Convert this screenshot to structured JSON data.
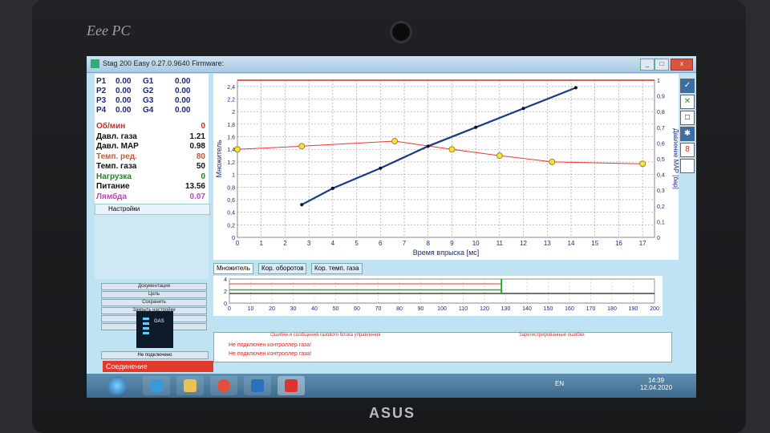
{
  "device": {
    "brand": "Eee PC",
    "maker": "ASUS"
  },
  "window": {
    "title": "Stag 200 Easy 0.27.0.9640 Firmware:"
  },
  "injectors": [
    {
      "p": "P1",
      "pval": "0.00",
      "g": "G1",
      "gval": "0.00"
    },
    {
      "p": "P2",
      "pval": "0.00",
      "g": "G2",
      "gval": "0.00"
    },
    {
      "p": "P3",
      "pval": "0.00",
      "g": "G3",
      "gval": "0.00"
    },
    {
      "p": "P4",
      "pval": "0.00",
      "g": "G4",
      "gval": "0.00"
    }
  ],
  "params": [
    {
      "label": "Об/мин",
      "value": "0",
      "color": "#cc2a2a"
    },
    {
      "label": "Давл. газа",
      "value": "1.21",
      "color": "#111111"
    },
    {
      "label": "Давл. MAP",
      "value": "0.98",
      "color": "#111111"
    },
    {
      "label": "Темп. ред.",
      "value": "80",
      "color": "#d2552a"
    },
    {
      "label": "Темп. газа",
      "value": "50",
      "color": "#111111"
    },
    {
      "label": "Нагрузка",
      "value": "0",
      "color": "#2a7a2a"
    },
    {
      "label": "Питание",
      "value": "13.56",
      "color": "#111111"
    },
    {
      "label": "Лямбда",
      "value": "0.07",
      "color": "#cc3acc"
    }
  ],
  "settings_label": "Настройки",
  "menu_items": [
    "Документация",
    "Цель",
    "Сохранить",
    "Закрыть настройки",
    "Сохранить",
    "Открыть"
  ],
  "gas_box_label": "GAS",
  "unconnected_label": "Не подключено",
  "connection_label": "Соединение",
  "tabs": [
    "Множитель",
    "Кор. оборотов",
    "Кор. темп. газа"
  ],
  "messages": {
    "header_left": "Ошибки и сообщения газового блока управления",
    "header_right": "Зарегистрированные ошибки",
    "lines": [
      "Не подключен контроллер газа!",
      "Не подключен контроллер газа!"
    ]
  },
  "tray": {
    "lang": "EN",
    "time": "14:39",
    "date": "12.04.2020"
  },
  "colors": {
    "accent": "#e03a2c",
    "window_bg": "#bfe3f2"
  },
  "chart_data": {
    "type": "scatter",
    "xlabel": "Время впрыска [мс]",
    "ylabel": "Множитель",
    "ylabel_right": "Давление MAP [бар]",
    "xlim": [
      0,
      17.5
    ],
    "ylim": [
      0,
      2.5
    ],
    "ylim_right": [
      0,
      1.0
    ],
    "x_ticks": [
      "0",
      "1",
      "2",
      "3",
      "4",
      "5",
      "6",
      "7",
      "8",
      "9",
      "10",
      "11",
      "12",
      "13",
      "14",
      "15",
      "16",
      "17"
    ],
    "y_ticks": [
      "0",
      "0,2",
      "0,4",
      "0,6",
      "0,8",
      "1",
      "1,2",
      "1,4",
      "1,6",
      "1,8",
      "2",
      "2,2",
      "2,4"
    ],
    "y_ticks_right": [
      "0",
      "0,1",
      "0,2",
      "0,3",
      "0,4",
      "0,5",
      "0,6",
      "0,7",
      "0,8",
      "0,9",
      "1"
    ],
    "series": [
      {
        "points": [
          [
            0,
            1.4
          ],
          [
            2.7,
            1.45
          ],
          [
            6.6,
            1.53
          ],
          [
            9,
            1.4
          ],
          [
            11,
            1.3
          ],
          [
            13.2,
            1.2
          ],
          [
            17,
            1.17
          ]
        ]
      },
      {
        "points": [
          [
            2.7,
            0.52
          ],
          [
            4,
            0.78
          ],
          [
            6,
            1.1
          ],
          [
            8,
            1.45
          ],
          [
            10,
            1.75
          ],
          [
            12,
            2.05
          ],
          [
            14.2,
            2.38
          ]
        ]
      }
    ]
  },
  "strip_data": {
    "type": "line",
    "x_ticks": [
      "0",
      "10",
      "20",
      "30",
      "40",
      "50",
      "60",
      "70",
      "80",
      "90",
      "100",
      "110",
      "120",
      "130",
      "140",
      "150",
      "160",
      "170",
      "180",
      "190",
      "200"
    ],
    "y_ticks": [
      "0",
      "2",
      "4"
    ],
    "xlim": [
      0,
      200
    ],
    "ylim": [
      0,
      4
    ]
  }
}
